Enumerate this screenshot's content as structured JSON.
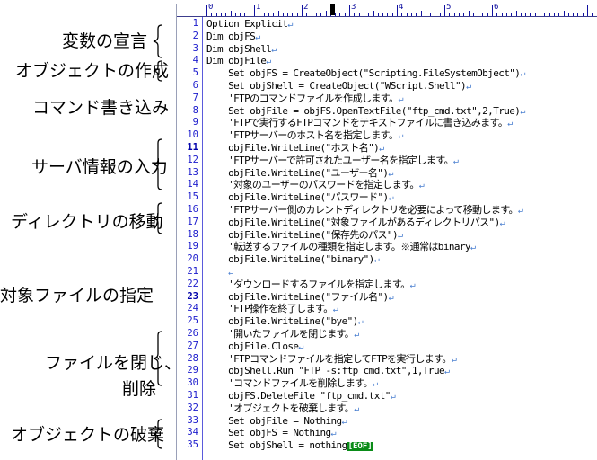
{
  "annotations": [
    {
      "label": "変数の宣言"
    },
    {
      "label": "オブジェクトの作成"
    },
    {
      "label": "コマンド書き込み"
    },
    {
      "label": "サーバ情報の入力"
    },
    {
      "label": "ディレクトリの移動"
    },
    {
      "label": "対象ファイルの指定"
    },
    {
      "label": "ファイルを閉じ、"
    },
    {
      "label": "削除"
    },
    {
      "label": "オブジェクトの破棄"
    }
  ],
  "ruler": {
    "marks": [
      "0",
      "1",
      "2",
      "3",
      "4",
      "5",
      "6"
    ]
  },
  "editor": {
    "eof_marker": "[EOF]",
    "return_mark": "↵",
    "lines": [
      {
        "n": "1",
        "text": "Option Explicit",
        "ret": true
      },
      {
        "n": "2",
        "text": "Dim objFS",
        "ret": true
      },
      {
        "n": "3",
        "text": "Dim objShell",
        "ret": true
      },
      {
        "n": "4",
        "text": "Dim objFile",
        "ret": true
      },
      {
        "n": "5",
        "text": "    Set objFS = CreateObject(\"Scripting.FileSystemObject\")",
        "ret": true
      },
      {
        "n": "6",
        "text": "    Set objShell = CreateObject(\"WScript.Shell\")",
        "ret": true
      },
      {
        "n": "7",
        "text": "    'FTPのコマンドファイルを作成します。",
        "ret": true
      },
      {
        "n": "8",
        "text": "    Set objFile = objFS.OpenTextFile(\"ftp_cmd.txt\",2,True)",
        "ret": true
      },
      {
        "n": "9",
        "text": "    'FTPで実行するFTPコマンドをテキストファイルに書き込みます。",
        "ret": true
      },
      {
        "n": "10",
        "text": "    'FTPサーバーのホスト名を指定します。",
        "ret": true
      },
      {
        "n": "11",
        "text": "    objFile.WriteLine(\"ホスト名\")",
        "ret": true
      },
      {
        "n": "12",
        "text": "    'FTPサーバーで許可されたユーザー名を指定します。",
        "ret": true
      },
      {
        "n": "13",
        "text": "    objFile.WriteLine(\"ユーザー名\")",
        "ret": true
      },
      {
        "n": "14",
        "text": "    '対象のユーザーのパスワードを指定します。",
        "ret": true
      },
      {
        "n": "15",
        "text": "    objFile.WriteLine(\"パスワード\")",
        "ret": true
      },
      {
        "n": "16",
        "text": "    'FTPサーバー側のカレントディレクトリを必要によって移動します。",
        "ret": true
      },
      {
        "n": "17",
        "text": "    objFile.WriteLine(\"対象ファイルがあるディレクトリパス\")",
        "ret": true
      },
      {
        "n": "18",
        "text": "    objFile.WriteLine(\"保存先のパス\")",
        "ret": true
      },
      {
        "n": "19",
        "text": "    '転送するファイルの種類を指定します。※通常はbinary",
        "ret": true
      },
      {
        "n": "20",
        "text": "    objFile.WriteLine(\"binary\")",
        "ret": true
      },
      {
        "n": "21",
        "text": "    ",
        "ret": true
      },
      {
        "n": "22",
        "text": "    'ダウンロードするファイルを指定します。",
        "ret": true
      },
      {
        "n": "23",
        "text": "    objFile.WriteLine(\"ファイル名\")",
        "ret": true
      },
      {
        "n": "24",
        "text": "    'FTP操作を終了します。",
        "ret": true
      },
      {
        "n": "25",
        "text": "    objFile.WriteLine(\"bye\")",
        "ret": true
      },
      {
        "n": "26",
        "text": "    '開いたファイルを閉じます。",
        "ret": true
      },
      {
        "n": "27",
        "text": "    objFile.Close",
        "ret": true
      },
      {
        "n": "28",
        "text": "    'FTPコマンドファイルを指定してFTPを実行します。",
        "ret": true
      },
      {
        "n": "29",
        "text": "    objShell.Run \"FTP -s:ftp_cmd.txt\",1,True",
        "ret": true
      },
      {
        "n": "30",
        "text": "    'コマンドファイルを削除します。",
        "ret": true
      },
      {
        "n": "31",
        "text": "    objFS.DeleteFile \"ftp_cmd.txt\"",
        "ret": true
      },
      {
        "n": "32",
        "text": "    'オブジェクトを破棄します。",
        "ret": true
      },
      {
        "n": "33",
        "text": "    Set objFile = Nothing",
        "ret": true
      },
      {
        "n": "34",
        "text": "    Set objFS = Nothing",
        "ret": true
      },
      {
        "n": "35",
        "text": "    Set objShell = nothing",
        "ret": false,
        "eof": true
      }
    ]
  }
}
